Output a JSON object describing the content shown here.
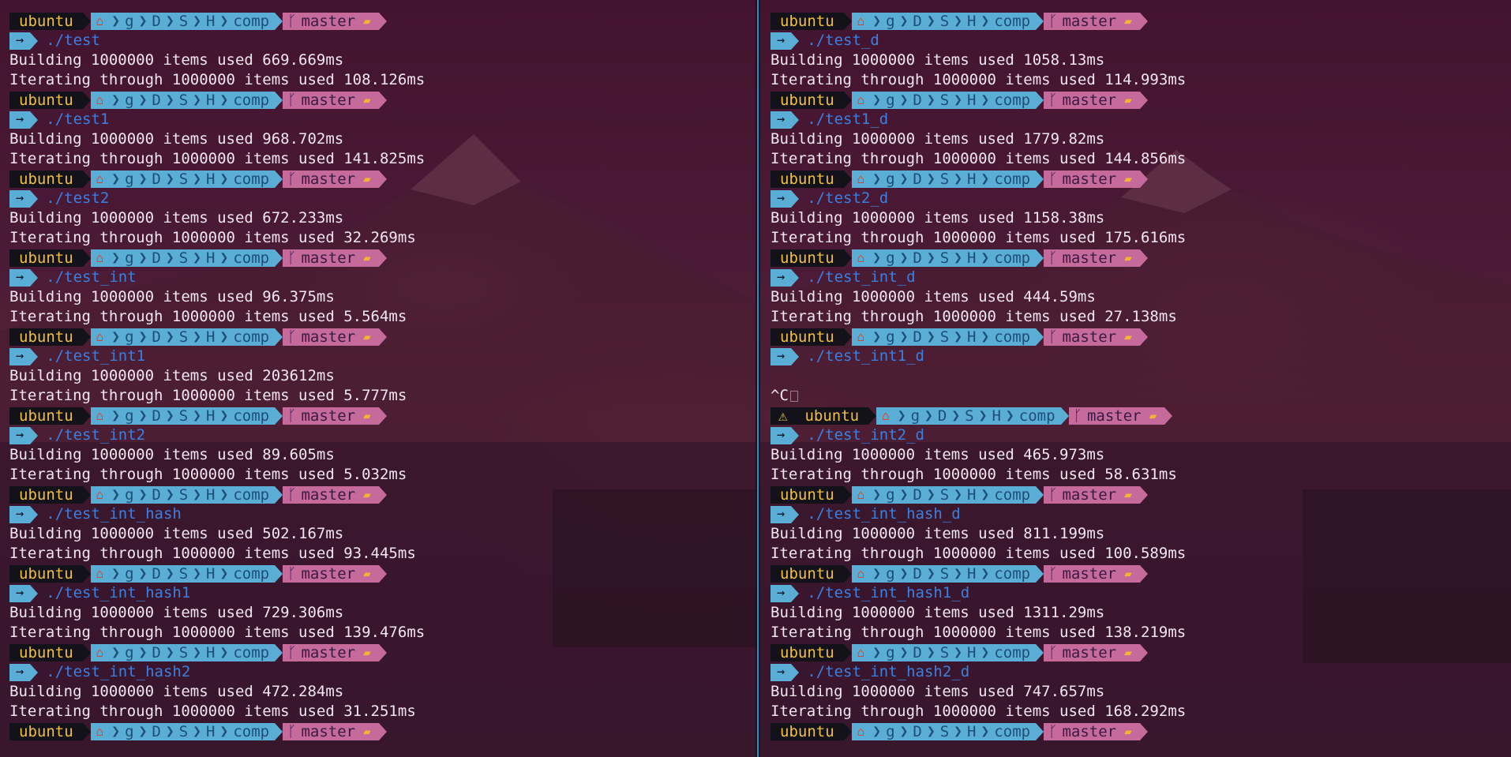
{
  "prompt": {
    "host": "ubuntu",
    "home_icon": "home-icon",
    "path": [
      "g",
      "D",
      "S",
      "H",
      "comp"
    ],
    "branch_icon": "git-branch-icon",
    "branch": "master",
    "folder_icon": "folder-icon",
    "cmd_arrow": "→",
    "warn_icon": "⚠"
  },
  "left": {
    "runs": [
      {
        "cmd": "./test",
        "build": "Building 1000000 items used 669.669ms",
        "iter": "Iterating through 1000000 items used 108.126ms"
      },
      {
        "cmd": "./test1",
        "build": "Building 1000000 items used 968.702ms",
        "iter": "Iterating through 1000000 items used 141.825ms"
      },
      {
        "cmd": "./test2",
        "build": "Building 1000000 items used 672.233ms",
        "iter": "Iterating through 1000000 items used 32.269ms"
      },
      {
        "cmd": "./test_int",
        "build": "Building 1000000 items used 96.375ms",
        "iter": "Iterating through 1000000 items used 5.564ms"
      },
      {
        "cmd": "./test_int1",
        "build": "Building 1000000 items used 203612ms",
        "iter": "Iterating through 1000000 items used 5.777ms"
      },
      {
        "cmd": "./test_int2",
        "build": "Building 1000000 items used 89.605ms",
        "iter": "Iterating through 1000000 items used 5.032ms"
      },
      {
        "cmd": "./test_int_hash",
        "build": "Building 1000000 items used 502.167ms",
        "iter": "Iterating through 1000000 items used 93.445ms"
      },
      {
        "cmd": "./test_int_hash1",
        "build": "Building 1000000 items used 729.306ms",
        "iter": "Iterating through 1000000 items used 139.476ms"
      },
      {
        "cmd": "./test_int_hash2",
        "build": "Building 1000000 items used 472.284ms",
        "iter": "Iterating through 1000000 items used 31.251ms"
      }
    ]
  },
  "right": {
    "runs": [
      {
        "cmd": "./test_d",
        "build": "Building 1000000 items used 1058.13ms",
        "iter": "Iterating through 1000000 items used 114.993ms"
      },
      {
        "cmd": "./test1_d",
        "build": "Building 1000000 items used 1779.82ms",
        "iter": "Iterating through 1000000 items used 144.856ms"
      },
      {
        "cmd": "./test2_d",
        "build": "Building 1000000 items used 1158.38ms",
        "iter": "Iterating through 1000000 items used 175.616ms"
      },
      {
        "cmd": "./test_int_d",
        "build": "Building 1000000 items used 444.59ms",
        "iter": "Iterating through 1000000 items used 27.138ms"
      },
      {
        "cmd": "./test_int1_d",
        "interrupted": "^C"
      },
      {
        "cmd": "./test_int2_d",
        "build": "Building 1000000 items used 465.973ms",
        "iter": "Iterating through 1000000 items used 58.631ms"
      },
      {
        "cmd": "./test_int_hash_d",
        "build": "Building 1000000 items used 811.199ms",
        "iter": "Iterating through 1000000 items used 100.589ms"
      },
      {
        "cmd": "./test_int_hash1_d",
        "build": "Building 1000000 items used 1311.29ms",
        "iter": "Iterating through 1000000 items used 138.219ms"
      },
      {
        "cmd": "./test_int_hash2_d",
        "build": "Building 1000000 items used 747.657ms",
        "iter": "Iterating through 1000000 items used 168.292ms"
      }
    ]
  },
  "colors": {
    "host_bg": "#13111a",
    "host_fg": "#f0c040",
    "path_bg": "#5aaed6",
    "git_bg": "#c56a9a",
    "cmd_fg": "#3b80e0",
    "pane_divider": "#2a8fc0"
  }
}
